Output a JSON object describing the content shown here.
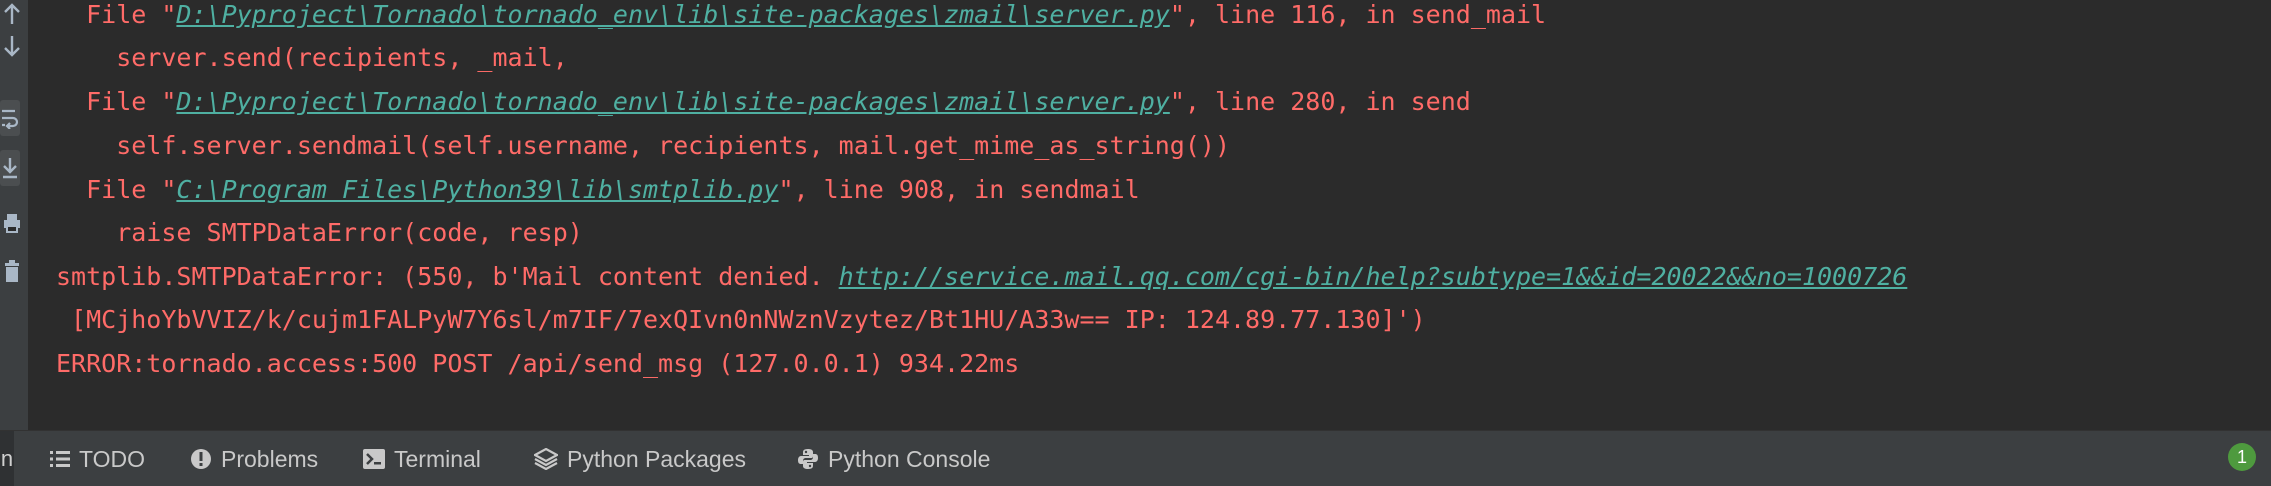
{
  "console": {
    "lines": [
      {
        "prefix": "  File \"",
        "link": "D:\\Pyproject\\Tornado\\tornado_env\\lib\\site-packages\\zmail\\server.py",
        "suffix": "\", line 116, in send_mail"
      },
      {
        "text": "    server.send(recipients, _mail,"
      },
      {
        "prefix": "  File \"",
        "link": "D:\\Pyproject\\Tornado\\tornado_env\\lib\\site-packages\\zmail\\server.py",
        "suffix": "\", line 280, in send"
      },
      {
        "text": "    self.server.sendmail(self.username, recipients, mail.get_mime_as_string())"
      },
      {
        "prefix": "  File \"",
        "link": "C:\\Program Files\\Python39\\lib\\smtplib.py",
        "suffix": "\", line 908, in sendmail"
      },
      {
        "text": "    raise SMTPDataError(code, resp)"
      },
      {
        "prefix": "smtplib.SMTPDataError: (550, b'Mail content denied. ",
        "link": "http://service.mail.qq.com/cgi-bin/help?subtype=1&&id=20022&&no=1000726",
        "suffix": ""
      },
      {
        "text": " [MCjhoYbVVIZ/k/cujm1FALPyW7Y6sl/m7IF/7exQIvn0nNWznVzytez/Bt1HU/A33w== IP: 124.89.77.130]')"
      },
      {
        "text": "ERROR:tornado.access:500 POST /api/send_msg (127.0.0.1) 934.22ms"
      }
    ]
  },
  "toolbar": {
    "left_stub": "n",
    "tabs": [
      {
        "label": "TODO",
        "icon": "list-icon"
      },
      {
        "label": "Problems",
        "icon": "info-circle-icon"
      },
      {
        "label": "Terminal",
        "icon": "terminal-icon"
      },
      {
        "label": "Python Packages",
        "icon": "layers-icon"
      },
      {
        "label": "Python Console",
        "icon": "python-icon"
      }
    ],
    "event_count": "1"
  },
  "colors": {
    "error_text": "#ff6b68",
    "link": "#4fb0a2",
    "background": "#2b2b2b",
    "toolbar_bg": "#3c3f41",
    "badge": "#4e9a3e"
  }
}
